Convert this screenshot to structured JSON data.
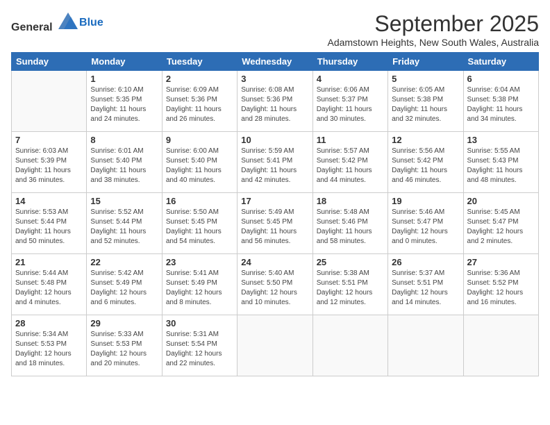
{
  "header": {
    "logo_general": "General",
    "logo_blue": "Blue",
    "month": "September 2025",
    "location": "Adamstown Heights, New South Wales, Australia"
  },
  "days_of_week": [
    "Sunday",
    "Monday",
    "Tuesday",
    "Wednesday",
    "Thursday",
    "Friday",
    "Saturday"
  ],
  "weeks": [
    [
      {
        "day": "",
        "info": ""
      },
      {
        "day": "1",
        "info": "Sunrise: 6:10 AM\nSunset: 5:35 PM\nDaylight: 11 hours\nand 24 minutes."
      },
      {
        "day": "2",
        "info": "Sunrise: 6:09 AM\nSunset: 5:36 PM\nDaylight: 11 hours\nand 26 minutes."
      },
      {
        "day": "3",
        "info": "Sunrise: 6:08 AM\nSunset: 5:36 PM\nDaylight: 11 hours\nand 28 minutes."
      },
      {
        "day": "4",
        "info": "Sunrise: 6:06 AM\nSunset: 5:37 PM\nDaylight: 11 hours\nand 30 minutes."
      },
      {
        "day": "5",
        "info": "Sunrise: 6:05 AM\nSunset: 5:38 PM\nDaylight: 11 hours\nand 32 minutes."
      },
      {
        "day": "6",
        "info": "Sunrise: 6:04 AM\nSunset: 5:38 PM\nDaylight: 11 hours\nand 34 minutes."
      }
    ],
    [
      {
        "day": "7",
        "info": "Sunrise: 6:03 AM\nSunset: 5:39 PM\nDaylight: 11 hours\nand 36 minutes."
      },
      {
        "day": "8",
        "info": "Sunrise: 6:01 AM\nSunset: 5:40 PM\nDaylight: 11 hours\nand 38 minutes."
      },
      {
        "day": "9",
        "info": "Sunrise: 6:00 AM\nSunset: 5:40 PM\nDaylight: 11 hours\nand 40 minutes."
      },
      {
        "day": "10",
        "info": "Sunrise: 5:59 AM\nSunset: 5:41 PM\nDaylight: 11 hours\nand 42 minutes."
      },
      {
        "day": "11",
        "info": "Sunrise: 5:57 AM\nSunset: 5:42 PM\nDaylight: 11 hours\nand 44 minutes."
      },
      {
        "day": "12",
        "info": "Sunrise: 5:56 AM\nSunset: 5:42 PM\nDaylight: 11 hours\nand 46 minutes."
      },
      {
        "day": "13",
        "info": "Sunrise: 5:55 AM\nSunset: 5:43 PM\nDaylight: 11 hours\nand 48 minutes."
      }
    ],
    [
      {
        "day": "14",
        "info": "Sunrise: 5:53 AM\nSunset: 5:44 PM\nDaylight: 11 hours\nand 50 minutes."
      },
      {
        "day": "15",
        "info": "Sunrise: 5:52 AM\nSunset: 5:44 PM\nDaylight: 11 hours\nand 52 minutes."
      },
      {
        "day": "16",
        "info": "Sunrise: 5:50 AM\nSunset: 5:45 PM\nDaylight: 11 hours\nand 54 minutes."
      },
      {
        "day": "17",
        "info": "Sunrise: 5:49 AM\nSunset: 5:45 PM\nDaylight: 11 hours\nand 56 minutes."
      },
      {
        "day": "18",
        "info": "Sunrise: 5:48 AM\nSunset: 5:46 PM\nDaylight: 11 hours\nand 58 minutes."
      },
      {
        "day": "19",
        "info": "Sunrise: 5:46 AM\nSunset: 5:47 PM\nDaylight: 12 hours\nand 0 minutes."
      },
      {
        "day": "20",
        "info": "Sunrise: 5:45 AM\nSunset: 5:47 PM\nDaylight: 12 hours\nand 2 minutes."
      }
    ],
    [
      {
        "day": "21",
        "info": "Sunrise: 5:44 AM\nSunset: 5:48 PM\nDaylight: 12 hours\nand 4 minutes."
      },
      {
        "day": "22",
        "info": "Sunrise: 5:42 AM\nSunset: 5:49 PM\nDaylight: 12 hours\nand 6 minutes."
      },
      {
        "day": "23",
        "info": "Sunrise: 5:41 AM\nSunset: 5:49 PM\nDaylight: 12 hours\nand 8 minutes."
      },
      {
        "day": "24",
        "info": "Sunrise: 5:40 AM\nSunset: 5:50 PM\nDaylight: 12 hours\nand 10 minutes."
      },
      {
        "day": "25",
        "info": "Sunrise: 5:38 AM\nSunset: 5:51 PM\nDaylight: 12 hours\nand 12 minutes."
      },
      {
        "day": "26",
        "info": "Sunrise: 5:37 AM\nSunset: 5:51 PM\nDaylight: 12 hours\nand 14 minutes."
      },
      {
        "day": "27",
        "info": "Sunrise: 5:36 AM\nSunset: 5:52 PM\nDaylight: 12 hours\nand 16 minutes."
      }
    ],
    [
      {
        "day": "28",
        "info": "Sunrise: 5:34 AM\nSunset: 5:53 PM\nDaylight: 12 hours\nand 18 minutes."
      },
      {
        "day": "29",
        "info": "Sunrise: 5:33 AM\nSunset: 5:53 PM\nDaylight: 12 hours\nand 20 minutes."
      },
      {
        "day": "30",
        "info": "Sunrise: 5:31 AM\nSunset: 5:54 PM\nDaylight: 12 hours\nand 22 minutes."
      },
      {
        "day": "",
        "info": ""
      },
      {
        "day": "",
        "info": ""
      },
      {
        "day": "",
        "info": ""
      },
      {
        "day": "",
        "info": ""
      }
    ]
  ]
}
